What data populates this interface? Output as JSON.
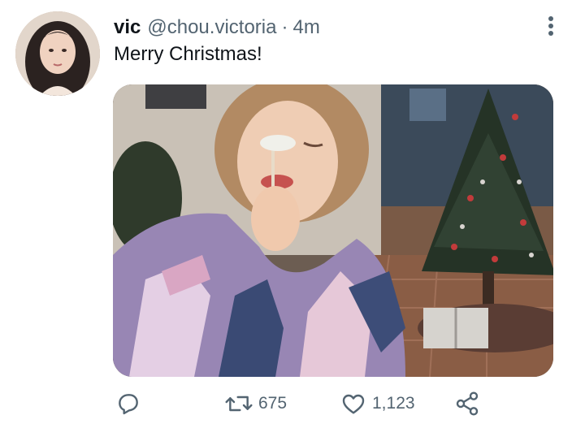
{
  "tweet": {
    "author": {
      "name": "vic",
      "handle": "@chou.victoria",
      "avatar_icon": "profile-photo"
    },
    "separator": "·",
    "time": "4m",
    "text": "Merry Christmas!",
    "media": {
      "kind": "photo",
      "description_icon": "photo"
    },
    "actions": {
      "reply": {
        "icon": "reply-icon",
        "count": ""
      },
      "retweet": {
        "icon": "retweet-icon",
        "count": "675"
      },
      "like": {
        "icon": "heart-icon",
        "count": "1,123"
      },
      "share": {
        "icon": "share-icon"
      }
    },
    "more_icon": "more-vertical-icon"
  },
  "colors": {
    "text_primary": "#0f1419",
    "text_secondary": "#536471",
    "background": "#ffffff"
  }
}
